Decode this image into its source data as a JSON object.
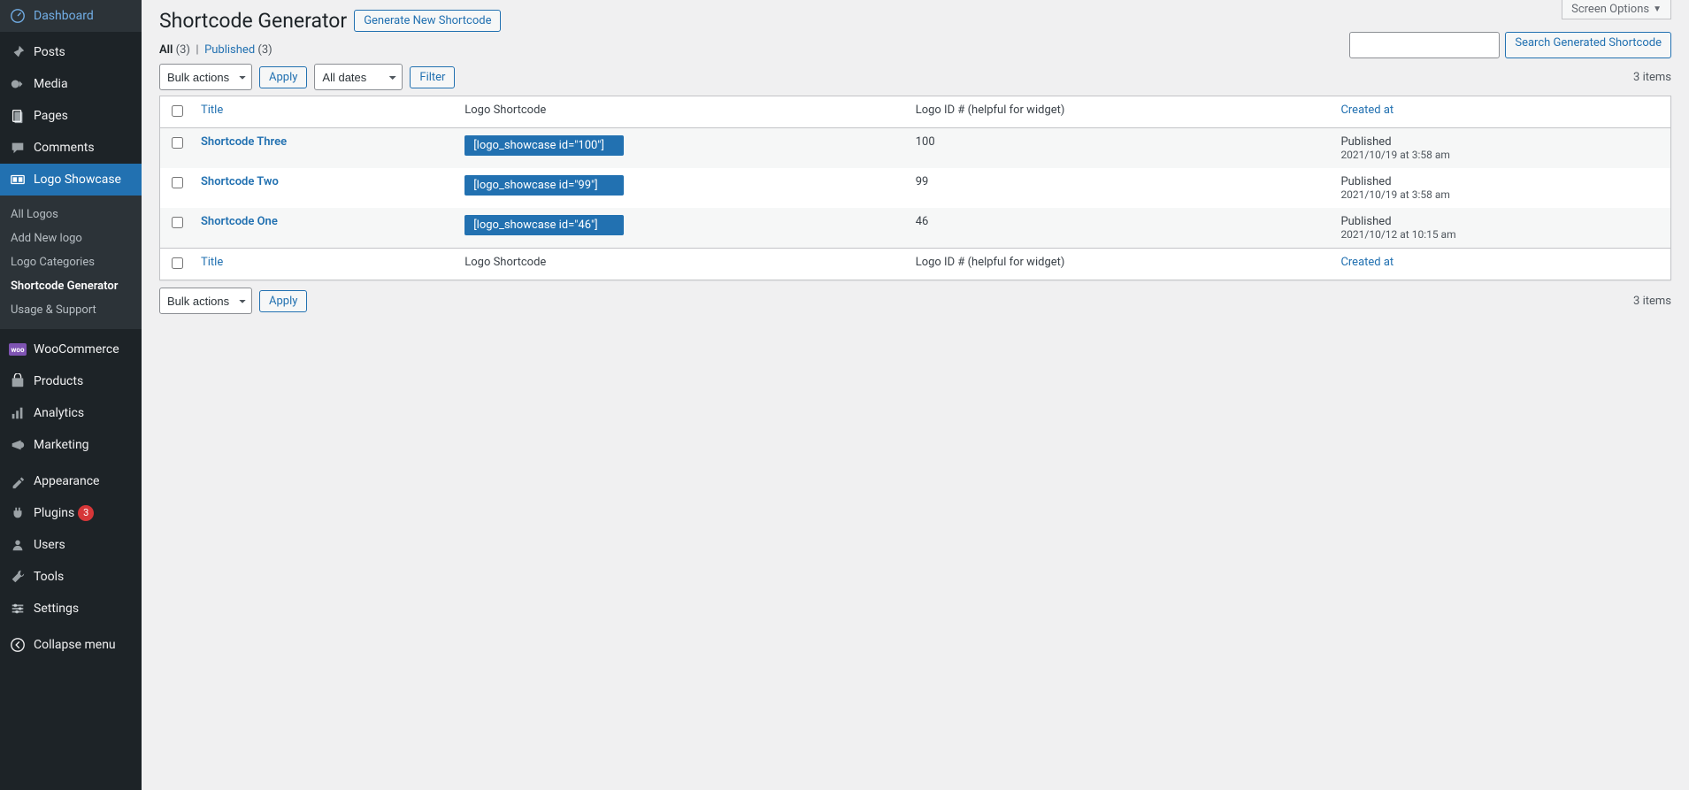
{
  "screen_options": "Screen Options",
  "sidebar": {
    "items": [
      {
        "label": "Dashboard",
        "icon": "dashboard"
      },
      {
        "label": "Posts",
        "icon": "pin"
      },
      {
        "label": "Media",
        "icon": "media"
      },
      {
        "label": "Pages",
        "icon": "pages"
      },
      {
        "label": "Comments",
        "icon": "comments"
      },
      {
        "label": "Logo Showcase",
        "icon": "showcase",
        "active": true
      },
      {
        "label": "WooCommerce",
        "icon": "woo"
      },
      {
        "label": "Products",
        "icon": "products"
      },
      {
        "label": "Analytics",
        "icon": "analytics"
      },
      {
        "label": "Marketing",
        "icon": "marketing"
      },
      {
        "label": "Appearance",
        "icon": "appearance"
      },
      {
        "label": "Plugins",
        "icon": "plugins",
        "badge": "3"
      },
      {
        "label": "Users",
        "icon": "users"
      },
      {
        "label": "Tools",
        "icon": "tools"
      },
      {
        "label": "Settings",
        "icon": "settings"
      },
      {
        "label": "Collapse menu",
        "icon": "collapse"
      }
    ],
    "submenu": [
      {
        "label": "All Logos"
      },
      {
        "label": "Add New logo"
      },
      {
        "label": "Logo Categories"
      },
      {
        "label": "Shortcode Generator",
        "current": true
      },
      {
        "label": "Usage & Support"
      }
    ]
  },
  "header": {
    "title": "Shortcode Generator",
    "new_button": "Generate New Shortcode"
  },
  "subsubsub": {
    "all_label": "All",
    "all_count": "(3)",
    "sep": "|",
    "published_label": "Published",
    "published_count": "(3)"
  },
  "filters": {
    "bulk_actions": "Bulk actions",
    "apply": "Apply",
    "all_dates": "All dates",
    "filter": "Filter",
    "items_count": "3 items",
    "search_btn": "Search Generated Shortcode"
  },
  "table": {
    "col_title": "Title",
    "col_shortcode": "Logo Shortcode",
    "col_logo_id": "Logo ID # (helpful for widget)",
    "col_created": "Created at",
    "rows": [
      {
        "title": "Shortcode Three",
        "shortcode": "[logo_showcase id=\"100\"]",
        "logo_id": "100",
        "state": "Published",
        "date": "2021/10/19 at 3:58 am"
      },
      {
        "title": "Shortcode Two",
        "shortcode": "[logo_showcase id=\"99\"]",
        "logo_id": "99",
        "state": "Published",
        "date": "2021/10/19 at 3:58 am"
      },
      {
        "title": "Shortcode One",
        "shortcode": "[logo_showcase id=\"46\"]",
        "logo_id": "46",
        "state": "Published",
        "date": "2021/10/12 at 10:15 am"
      }
    ]
  }
}
